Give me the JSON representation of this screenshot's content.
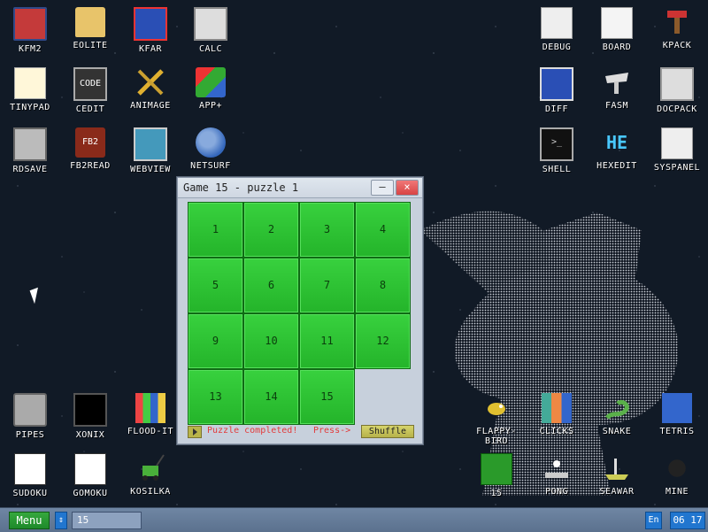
{
  "desktop": {
    "icons": [
      {
        "label": "KFM2"
      },
      {
        "label": "EOLITE"
      },
      {
        "label": "KFAR"
      },
      {
        "label": "CALC"
      },
      {
        "label": "DEBUG"
      },
      {
        "label": "BOARD"
      },
      {
        "label": "KPACK"
      },
      {
        "label": "TINYPAD"
      },
      {
        "label": "CEDIT"
      },
      {
        "label": "ANIMAGE"
      },
      {
        "label": "APP+"
      },
      {
        "label": "DIFF"
      },
      {
        "label": "FASM"
      },
      {
        "label": "DOCPACK"
      },
      {
        "label": "RDSAVE"
      },
      {
        "label": "FB2READ"
      },
      {
        "label": "WEBVIEW"
      },
      {
        "label": "NETSURF"
      },
      {
        "label": "SHELL"
      },
      {
        "label": "HEXEDIT"
      },
      {
        "label": "SYSPANEL"
      },
      {
        "label": "PIPES"
      },
      {
        "label": "XONIX"
      },
      {
        "label": "FLOOD-IT"
      },
      {
        "label": "FLAPPY-BIRD"
      },
      {
        "label": "CLICKS"
      },
      {
        "label": "SNAKE"
      },
      {
        "label": "TETRIS"
      },
      {
        "label": "SUDOKU"
      },
      {
        "label": "GOMOKU"
      },
      {
        "label": "KOSILKA"
      },
      {
        "label": "15"
      },
      {
        "label": "PONG"
      },
      {
        "label": "SEAWAR"
      },
      {
        "label": "MINE"
      }
    ]
  },
  "window": {
    "title": "Game 15 - puzzle 1",
    "minimize_label": "–",
    "close_label": "×",
    "tiles": [
      "1",
      "2",
      "3",
      "4",
      "5",
      "6",
      "7",
      "8",
      "9",
      "10",
      "11",
      "12",
      "13",
      "14",
      "15"
    ],
    "status_message": "Puzzle completed!",
    "press_label": "Press->",
    "shuffle_label": "Shuffle"
  },
  "taskbar": {
    "menu_label": "Menu",
    "arrow_label": "⇕",
    "active_task": "15",
    "language": "En",
    "clock": "06 17"
  },
  "colors": {
    "desktop_bg": "#111a26",
    "tile_green": "#2fc036",
    "taskbar": "#6f86a3",
    "accent_blue": "#2176cf",
    "status_red": "#e23b3b"
  }
}
